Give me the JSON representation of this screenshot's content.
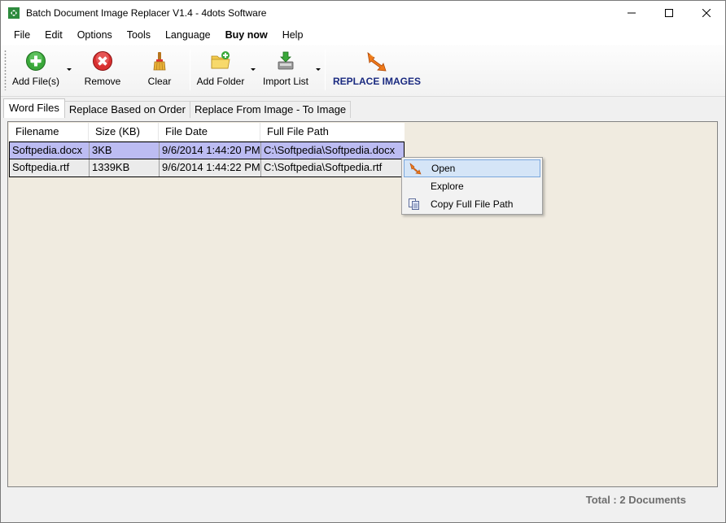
{
  "window": {
    "title": "Batch Document Image Replacer V1.4 - 4dots Software",
    "controls": {
      "minimize": "minimize-icon",
      "maximize": "maximize-icon",
      "close": "close-icon"
    }
  },
  "menu": {
    "items": [
      "File",
      "Edit",
      "Options",
      "Tools",
      "Language",
      "Buy now",
      "Help"
    ]
  },
  "toolbar": {
    "add_files": "Add File(s)",
    "remove": "Remove",
    "clear": "Clear",
    "add_folder": "Add Folder",
    "import_list": "Import List",
    "replace_images": "REPLACE IMAGES"
  },
  "tabs": [
    "Word Files",
    "Replace Based on Order",
    "Replace From Image - To Image"
  ],
  "table": {
    "columns": [
      "Filename",
      "Size (KB)",
      "File Date",
      "Full File Path"
    ],
    "rows": [
      [
        "Softpedia.docx",
        "3KB",
        "9/6/2014 1:44:20 PM",
        "C:\\Softpedia\\Softpedia.docx"
      ],
      [
        "Softpedia.rtf",
        "1339KB",
        "9/6/2014 1:44:22 PM",
        "C:\\Softpedia\\Softpedia.rtf"
      ]
    ]
  },
  "context_menu": {
    "items": [
      "Open",
      "Explore",
      "Copy Full File Path"
    ]
  },
  "status": {
    "total": "Total : 2 Documents"
  },
  "colors": {
    "selected_row": "#bcbcf2",
    "panel_bg": "#f0ebe0",
    "replace_text": "#1a2a80",
    "status_text": "#6e6e6e"
  }
}
